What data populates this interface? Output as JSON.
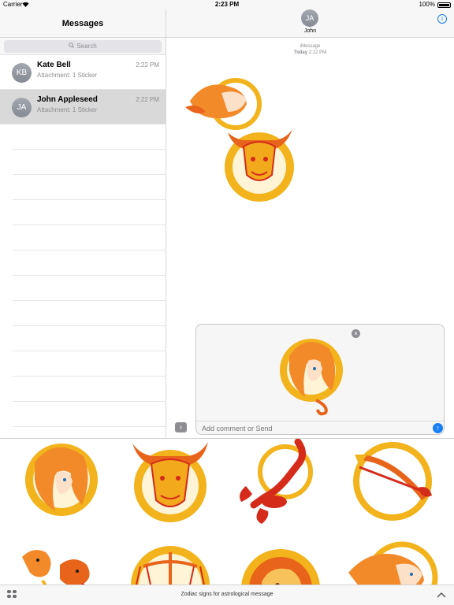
{
  "status": {
    "carrier": "Carrier",
    "time": "2:23 PM",
    "battery": "100%"
  },
  "left": {
    "title": "Messages",
    "search_placeholder": "Search",
    "conversations": [
      {
        "initials": "KB",
        "name": "Kate Bell",
        "preview": "Attachment: 1 Sticker",
        "time": "2:22 PM"
      },
      {
        "initials": "JA",
        "name": "John Appleseed",
        "preview": "Attachment: 1 Sticker",
        "time": "2:22 PM"
      }
    ]
  },
  "right": {
    "contact_initials": "JA",
    "contact_name": "John",
    "service": "iMessage",
    "date_label": "Today",
    "date_time": "2:22 PM"
  },
  "compose": {
    "placeholder": "Add comment or Send"
  },
  "drawer": {
    "title": "Zodiac signs for astrological message"
  },
  "icons": [
    "wifi-icon",
    "battery-icon",
    "search-icon",
    "info-icon",
    "remove-icon",
    "send-icon",
    "expand-icon",
    "app-grid-icon",
    "chevron-up-icon"
  ],
  "colors": {
    "accent": "#1a7ef5",
    "sticker_gold": "#f2b31c",
    "sticker_orange": "#e8641a",
    "sticker_red": "#d42b1b"
  }
}
